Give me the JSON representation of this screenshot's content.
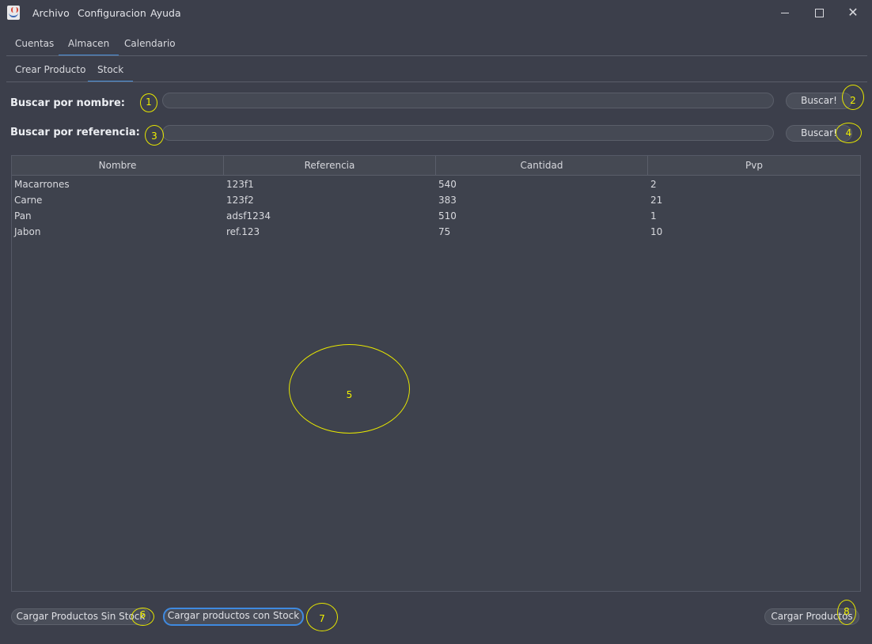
{
  "window": {
    "menus": [
      "Archivo",
      "Configuracion",
      "Ayuda"
    ],
    "controls": {
      "minimize": "",
      "maximize": "",
      "close": "✕"
    }
  },
  "main_tabs": [
    "Cuentas",
    "Almacen",
    "Calendario"
  ],
  "sub_tabs": [
    "Crear Producto",
    "Stock"
  ],
  "search": {
    "by_name_label": "Buscar por nombre:",
    "by_name_value": "",
    "by_name_button": "Buscar!",
    "by_ref_label": "Buscar por referencia:",
    "by_ref_value": "",
    "by_ref_button": "Buscar!"
  },
  "table": {
    "columns": [
      "Nombre",
      "Referencia",
      "Cantidad",
      "Pvp"
    ],
    "rows": [
      [
        "Macarrones",
        "123f1",
        "540",
        "2"
      ],
      [
        "Carne",
        "123f2",
        "383",
        "21"
      ],
      [
        "Pan",
        "adsf1234",
        "510",
        "1"
      ],
      [
        "Jabon",
        "ref.123",
        "75",
        "10"
      ]
    ]
  },
  "buttons": {
    "load_without_stock": "Cargar Productos Sin Stock",
    "load_with_stock": "Cargar productos con Stock",
    "load_products": "Cargar Productos"
  },
  "annotations": [
    "1",
    "2",
    "3",
    "4",
    "5",
    "6",
    "7",
    "8"
  ],
  "colors": {
    "accent": "#4a90d9",
    "annotation": "#e6e600",
    "background": "#3c3f4b"
  }
}
